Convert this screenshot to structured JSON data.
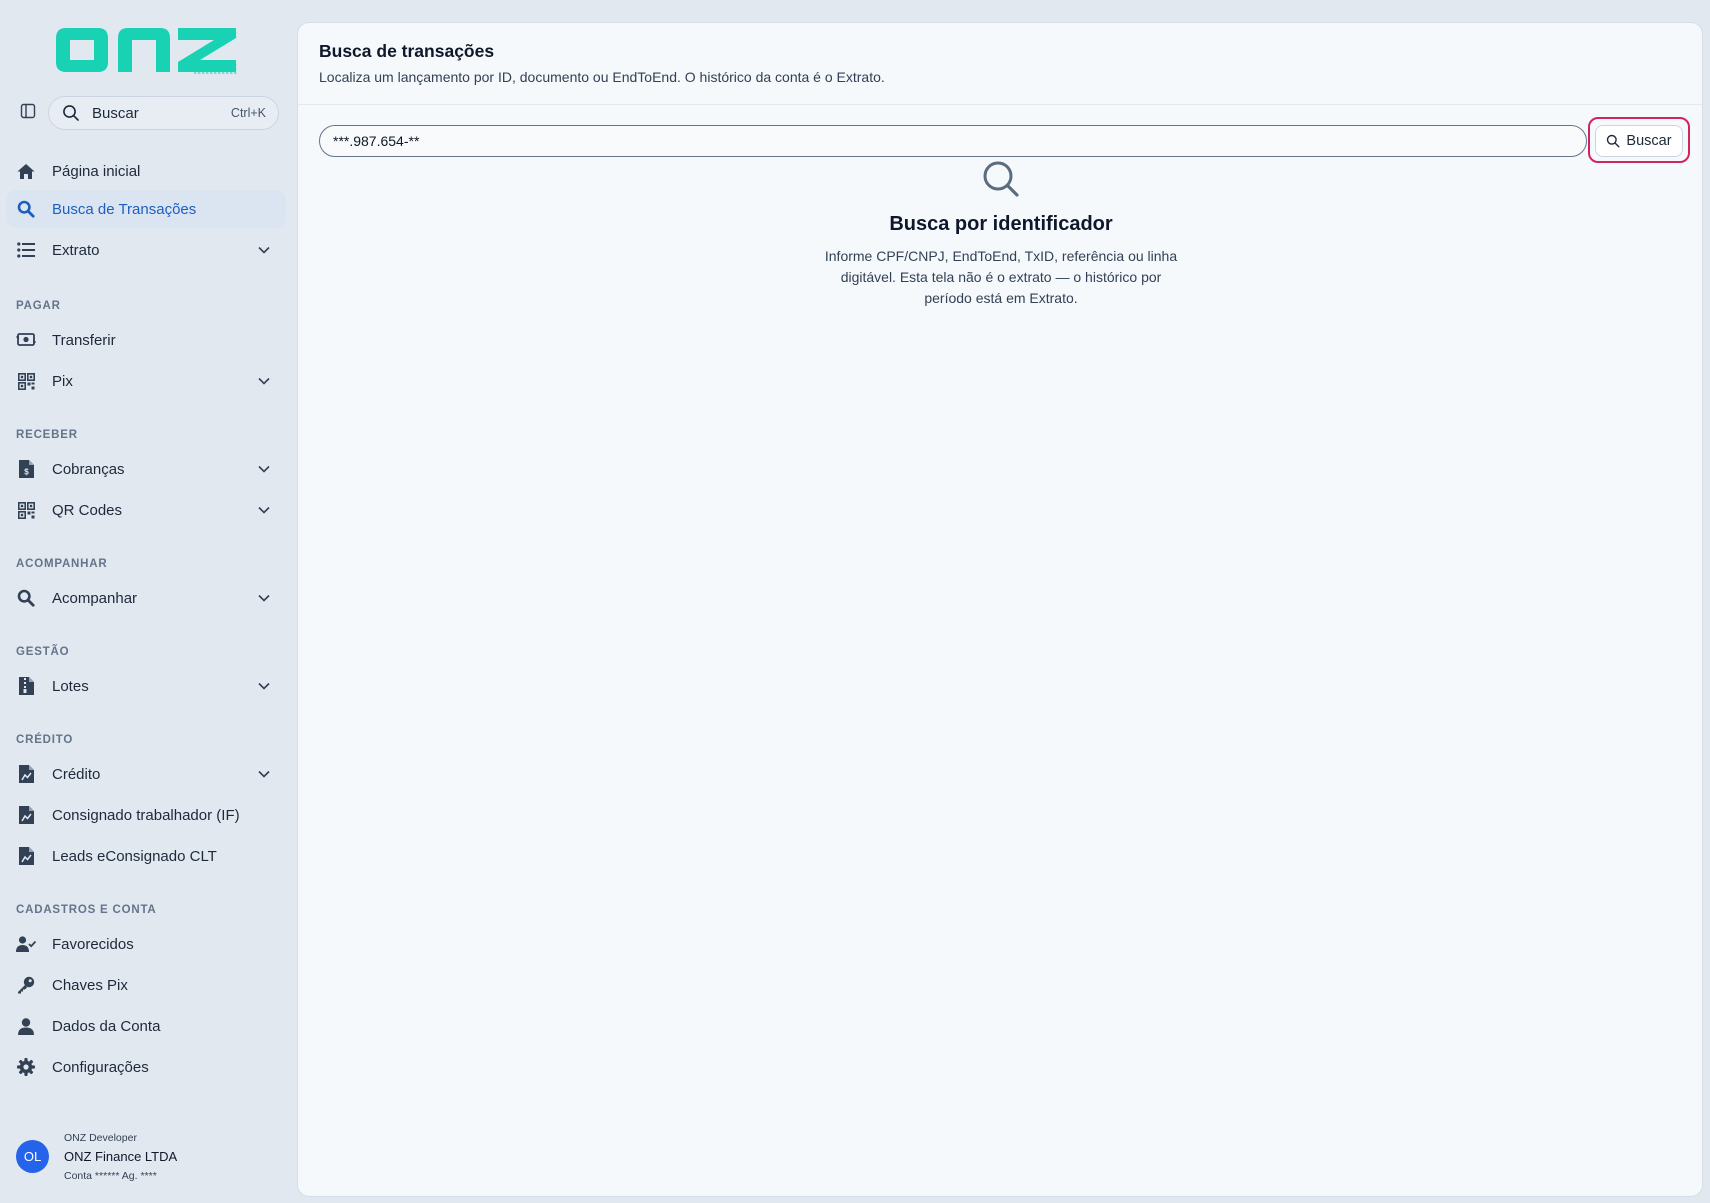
{
  "brand": {
    "logo_text": "onz",
    "accent": "#19d2b4"
  },
  "sidebar": {
    "toggle_icon": "sidebar-panel-icon",
    "search": {
      "label": "Buscar",
      "shortcut": "Ctrl+K",
      "icon": "search-icon"
    },
    "items": [
      {
        "label": "Página inicial",
        "icon": "home-icon",
        "active": false,
        "has_children": false
      },
      {
        "label": "Busca de Transações",
        "icon": "search-icon",
        "active": true,
        "has_children": false
      },
      {
        "label": "Extrato",
        "icon": "list-icon",
        "active": false,
        "has_children": true
      }
    ],
    "sections": [
      {
        "label": "PAGAR",
        "items": [
          {
            "label": "Transferir",
            "icon": "money-transfer-icon",
            "has_children": false
          },
          {
            "label": "Pix",
            "icon": "qr-grid-icon",
            "has_children": true
          }
        ]
      },
      {
        "label": "RECEBER",
        "items": [
          {
            "label": "Cobranças",
            "icon": "invoice-icon",
            "has_children": true
          },
          {
            "label": "QR Codes",
            "icon": "qr-grid-icon",
            "has_children": true
          }
        ]
      },
      {
        "label": "ACOMPANHAR",
        "items": [
          {
            "label": "Acompanhar",
            "icon": "search-icon",
            "has_children": true
          }
        ]
      },
      {
        "label": "GESTÃO",
        "items": [
          {
            "label": "Lotes",
            "icon": "file-zip-icon",
            "has_children": true
          }
        ]
      },
      {
        "label": "CRÉDITO",
        "items": [
          {
            "label": "Crédito",
            "icon": "document-chart-icon",
            "has_children": true
          },
          {
            "label": "Consignado trabalhador (IF)",
            "icon": "document-chart-icon",
            "has_children": false
          },
          {
            "label": "Leads eConsignado CLT",
            "icon": "document-chart-icon",
            "has_children": false
          }
        ]
      },
      {
        "label": "CADASTROS E CONTA",
        "items": [
          {
            "label": "Favorecidos",
            "icon": "user-check-icon",
            "has_children": false
          },
          {
            "label": "Chaves Pix",
            "icon": "key-icon",
            "has_children": false
          },
          {
            "label": "Dados da Conta",
            "icon": "user-icon",
            "has_children": false
          },
          {
            "label": "Configurações",
            "icon": "gear-icon",
            "has_children": false
          }
        ]
      }
    ],
    "user": {
      "initials": "OL",
      "role": "ONZ Developer",
      "company": "ONZ Finance LTDA",
      "account": "Conta ****** Ag. ****",
      "avatar_color": "#2563eb"
    }
  },
  "main": {
    "title": "Busca de transações",
    "subtitle": "Localiza um lançamento por ID, documento ou EndToEnd. O histórico da conta é o Extrato.",
    "search": {
      "value": "***.987.654-**",
      "button_label": "Buscar"
    },
    "empty_state": {
      "icon": "search-icon",
      "title": "Busca por identificador",
      "description": "Informe CPF/CNPJ, EndToEnd, TxID, referência ou linha digitável. Esta tela não é o extrato — o histórico por período está em Extrato."
    }
  },
  "colors": {
    "active_bg": "#dbe5f1",
    "active_text": "#1d5fbf",
    "focus_ring": "#d1245a"
  }
}
